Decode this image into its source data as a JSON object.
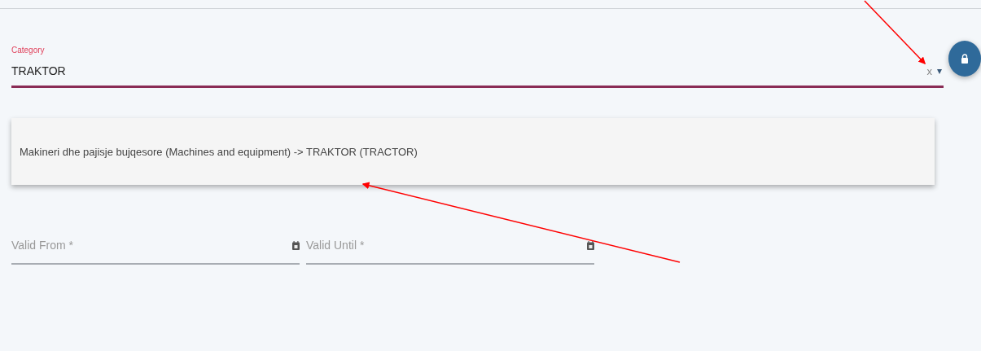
{
  "category": {
    "label": "Category",
    "value": "TRAKTOR",
    "clear": "x",
    "caret": "▾"
  },
  "suggestions": [
    {
      "text": "Makineri dhe pajisje bujqesore (Machines and equipment) -> TRAKTOR (TRACTOR)"
    }
  ],
  "date_fields": [
    {
      "placeholder": "Valid From *"
    },
    {
      "placeholder": "Valid Until *"
    }
  ]
}
